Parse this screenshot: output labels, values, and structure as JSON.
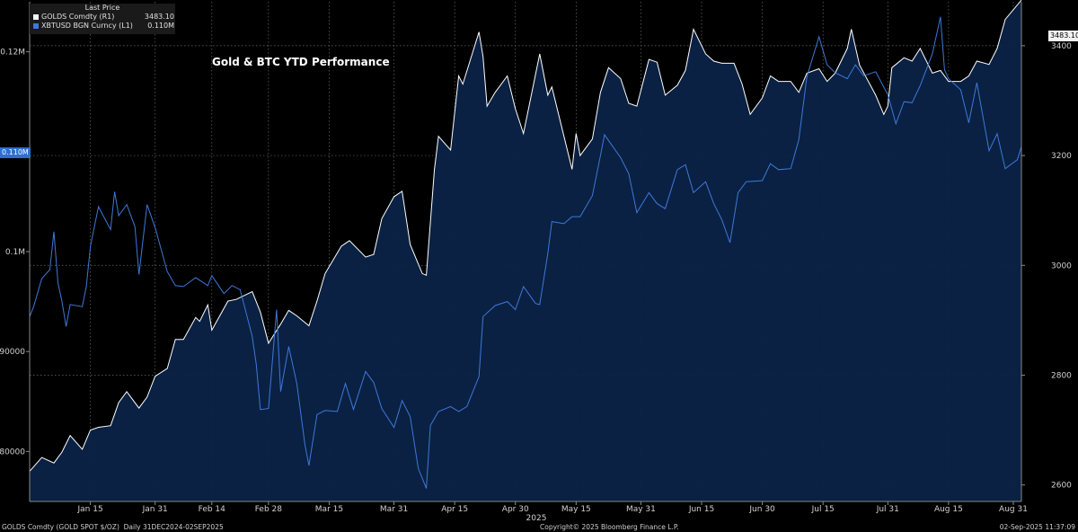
{
  "chart_data": {
    "type": "area",
    "title": "Gold & BTC YTD Performance",
    "x_tick_labels": [
      "Jan 15",
      "Jan 31",
      "Feb 14",
      "Feb 28",
      "Mar 15",
      "Mar 31",
      "Apr 15",
      "Apr 30",
      "May 15",
      "May 31",
      "Jun 15",
      "Jun 30",
      "Jul 15",
      "Jul 31",
      "Aug 15",
      "Aug 31"
    ],
    "x_year_label": "2025",
    "x_start": "2024-12-31",
    "x_end": "2025-09-02",
    "left_axis": {
      "ticks": [
        80000,
        90000,
        100000,
        120000
      ],
      "tick_labels": [
        "80000",
        "90000",
        "0.1M",
        "0.12M"
      ],
      "range": [
        75000,
        125000
      ]
    },
    "right_axis": {
      "ticks": [
        2600,
        2800,
        3000,
        3200,
        3400
      ],
      "tick_labels": [
        "2600",
        "2800",
        "3000",
        "3200",
        "3400"
      ],
      "range": [
        2570,
        3480
      ]
    },
    "series": [
      {
        "name": "GOLDS Comdty (R1)",
        "axis": "right",
        "color": "#ffffff",
        "last": "3483.10",
        "points": [
          [
            "2024-12-31",
            2625
          ],
          [
            "2025-01-03",
            2650
          ],
          [
            "2025-01-06",
            2640
          ],
          [
            "2025-01-08",
            2660
          ],
          [
            "2025-01-10",
            2690
          ],
          [
            "2025-01-13",
            2665
          ],
          [
            "2025-01-15",
            2700
          ],
          [
            "2025-01-17",
            2705
          ],
          [
            "2025-01-20",
            2708
          ],
          [
            "2025-01-22",
            2750
          ],
          [
            "2025-01-24",
            2770
          ],
          [
            "2025-01-27",
            2740
          ],
          [
            "2025-01-29",
            2760
          ],
          [
            "2025-01-31",
            2798
          ],
          [
            "2025-02-03",
            2812
          ],
          [
            "2025-02-05",
            2865
          ],
          [
            "2025-02-07",
            2865
          ],
          [
            "2025-02-10",
            2905
          ],
          [
            "2025-02-11",
            2898
          ],
          [
            "2025-02-13",
            2928
          ],
          [
            "2025-02-14",
            2882
          ],
          [
            "2025-02-18",
            2935
          ],
          [
            "2025-02-20",
            2938
          ],
          [
            "2025-02-24",
            2952
          ],
          [
            "2025-02-26",
            2915
          ],
          [
            "2025-02-28",
            2858
          ],
          [
            "2025-03-03",
            2893
          ],
          [
            "2025-03-05",
            2918
          ],
          [
            "2025-03-07",
            2908
          ],
          [
            "2025-03-10",
            2890
          ],
          [
            "2025-03-12",
            2935
          ],
          [
            "2025-03-14",
            2985
          ],
          [
            "2025-03-18",
            3035
          ],
          [
            "2025-03-20",
            3045
          ],
          [
            "2025-03-24",
            3015
          ],
          [
            "2025-03-26",
            3020
          ],
          [
            "2025-03-28",
            3085
          ],
          [
            "2025-03-31",
            3125
          ],
          [
            "2025-04-02",
            3135
          ],
          [
            "2025-04-04",
            3038
          ],
          [
            "2025-04-07",
            2985
          ],
          [
            "2025-04-08",
            2982
          ],
          [
            "2025-04-10",
            3175
          ],
          [
            "2025-04-11",
            3235
          ],
          [
            "2025-04-14",
            3210
          ],
          [
            "2025-04-16",
            3345
          ],
          [
            "2025-04-17",
            3330
          ],
          [
            "2025-04-21",
            3425
          ],
          [
            "2025-04-22",
            3380
          ],
          [
            "2025-04-23",
            3290
          ],
          [
            "2025-04-25",
            3315
          ],
          [
            "2025-04-28",
            3345
          ],
          [
            "2025-04-30",
            3285
          ],
          [
            "2025-05-02",
            3240
          ],
          [
            "2025-05-06",
            3385
          ],
          [
            "2025-05-08",
            3310
          ],
          [
            "2025-05-09",
            3325
          ],
          [
            "2025-05-12",
            3235
          ],
          [
            "2025-05-14",
            3175
          ],
          [
            "2025-05-15",
            3240
          ],
          [
            "2025-05-16",
            3200
          ],
          [
            "2025-05-19",
            3230
          ],
          [
            "2025-05-21",
            3315
          ],
          [
            "2025-05-23",
            3360
          ],
          [
            "2025-05-26",
            3340
          ],
          [
            "2025-05-28",
            3295
          ],
          [
            "2025-05-30",
            3290
          ],
          [
            "2025-06-02",
            3375
          ],
          [
            "2025-06-04",
            3370
          ],
          [
            "2025-06-06",
            3310
          ],
          [
            "2025-06-09",
            3328
          ],
          [
            "2025-06-11",
            3355
          ],
          [
            "2025-06-13",
            3430
          ],
          [
            "2025-06-16",
            3385
          ],
          [
            "2025-06-18",
            3372
          ],
          [
            "2025-06-20",
            3368
          ],
          [
            "2025-06-23",
            3368
          ],
          [
            "2025-06-25",
            3330
          ],
          [
            "2025-06-27",
            3275
          ],
          [
            "2025-06-30",
            3305
          ],
          [
            "2025-07-02",
            3345
          ],
          [
            "2025-07-04",
            3335
          ],
          [
            "2025-07-07",
            3335
          ],
          [
            "2025-07-09",
            3315
          ],
          [
            "2025-07-11",
            3350
          ],
          [
            "2025-07-14",
            3358
          ],
          [
            "2025-07-16",
            3335
          ],
          [
            "2025-07-18",
            3350
          ],
          [
            "2025-07-21",
            3395
          ],
          [
            "2025-07-22",
            3430
          ],
          [
            "2025-07-24",
            3365
          ],
          [
            "2025-07-28",
            3310
          ],
          [
            "2025-07-30",
            3275
          ],
          [
            "2025-07-31",
            3290
          ],
          [
            "2025-08-01",
            3360
          ],
          [
            "2025-08-04",
            3378
          ],
          [
            "2025-08-06",
            3372
          ],
          [
            "2025-08-08",
            3395
          ],
          [
            "2025-08-11",
            3350
          ],
          [
            "2025-08-13",
            3355
          ],
          [
            "2025-08-15",
            3335
          ],
          [
            "2025-08-18",
            3335
          ],
          [
            "2025-08-20",
            3345
          ],
          [
            "2025-08-22",
            3372
          ],
          [
            "2025-08-25",
            3366
          ],
          [
            "2025-08-27",
            3395
          ],
          [
            "2025-08-29",
            3448
          ],
          [
            "2025-09-02",
            3483.1
          ]
        ]
      },
      {
        "name": "XBTUSD BGN Curncy (L1)",
        "axis": "left",
        "color": "#3f78d8",
        "last": "0.110M",
        "points": [
          [
            "2024-12-31",
            93500
          ],
          [
            "2025-01-01",
            94500
          ],
          [
            "2025-01-03",
            97300
          ],
          [
            "2025-01-05",
            98200
          ],
          [
            "2025-01-06",
            102000
          ],
          [
            "2025-01-07",
            96900
          ],
          [
            "2025-01-08",
            95000
          ],
          [
            "2025-01-09",
            92500
          ],
          [
            "2025-01-10",
            94700
          ],
          [
            "2025-01-13",
            94500
          ],
          [
            "2025-01-14",
            96500
          ],
          [
            "2025-01-15",
            100500
          ],
          [
            "2025-01-17",
            104500
          ],
          [
            "2025-01-20",
            102200
          ],
          [
            "2025-01-21",
            106000
          ],
          [
            "2025-01-22",
            103600
          ],
          [
            "2025-01-24",
            104700
          ],
          [
            "2025-01-26",
            102500
          ],
          [
            "2025-01-27",
            97700
          ],
          [
            "2025-01-29",
            104700
          ],
          [
            "2025-01-31",
            102400
          ],
          [
            "2025-02-03",
            98000
          ],
          [
            "2025-02-05",
            96600
          ],
          [
            "2025-02-07",
            96500
          ],
          [
            "2025-02-10",
            97400
          ],
          [
            "2025-02-13",
            96600
          ],
          [
            "2025-02-14",
            97600
          ],
          [
            "2025-02-17",
            95800
          ],
          [
            "2025-02-19",
            96600
          ],
          [
            "2025-02-21",
            96200
          ],
          [
            "2025-02-24",
            91500
          ],
          [
            "2025-02-25",
            88700
          ],
          [
            "2025-02-26",
            84200
          ],
          [
            "2025-02-28",
            84300
          ],
          [
            "2025-03-02",
            94200
          ],
          [
            "2025-03-03",
            86000
          ],
          [
            "2025-03-05",
            90500
          ],
          [
            "2025-03-07",
            86800
          ],
          [
            "2025-03-09",
            80700
          ],
          [
            "2025-03-10",
            78600
          ],
          [
            "2025-03-12",
            83700
          ],
          [
            "2025-03-14",
            84100
          ],
          [
            "2025-03-17",
            84000
          ],
          [
            "2025-03-19",
            86800
          ],
          [
            "2025-03-21",
            84200
          ],
          [
            "2025-03-24",
            88000
          ],
          [
            "2025-03-26",
            86900
          ],
          [
            "2025-03-28",
            84300
          ],
          [
            "2025-03-31",
            82400
          ],
          [
            "2025-04-02",
            85100
          ],
          [
            "2025-04-04",
            83500
          ],
          [
            "2025-04-06",
            78300
          ],
          [
            "2025-04-08",
            76300
          ],
          [
            "2025-04-09",
            82600
          ],
          [
            "2025-04-11",
            84000
          ],
          [
            "2025-04-14",
            84500
          ],
          [
            "2025-04-16",
            84000
          ],
          [
            "2025-04-18",
            84500
          ],
          [
            "2025-04-21",
            87500
          ],
          [
            "2025-04-22",
            93500
          ],
          [
            "2025-04-25",
            94600
          ],
          [
            "2025-04-28",
            95000
          ],
          [
            "2025-04-30",
            94200
          ],
          [
            "2025-05-02",
            96500
          ],
          [
            "2025-05-05",
            94800
          ],
          [
            "2025-05-06",
            94700
          ],
          [
            "2025-05-08",
            99800
          ],
          [
            "2025-05-09",
            103000
          ],
          [
            "2025-05-12",
            102800
          ],
          [
            "2025-05-14",
            103500
          ],
          [
            "2025-05-16",
            103500
          ],
          [
            "2025-05-19",
            105600
          ],
          [
            "2025-05-21",
            109600
          ],
          [
            "2025-05-22",
            111700
          ],
          [
            "2025-05-26",
            109400
          ],
          [
            "2025-05-28",
            107800
          ],
          [
            "2025-05-30",
            103900
          ],
          [
            "2025-06-02",
            105900
          ],
          [
            "2025-06-04",
            104800
          ],
          [
            "2025-06-06",
            104300
          ],
          [
            "2025-06-09",
            108200
          ],
          [
            "2025-06-11",
            108700
          ],
          [
            "2025-06-13",
            105900
          ],
          [
            "2025-06-16",
            107000
          ],
          [
            "2025-06-18",
            104800
          ],
          [
            "2025-06-20",
            103200
          ],
          [
            "2025-06-22",
            100900
          ],
          [
            "2025-06-24",
            105900
          ],
          [
            "2025-06-26",
            107000
          ],
          [
            "2025-06-30",
            107100
          ],
          [
            "2025-07-02",
            108800
          ],
          [
            "2025-07-04",
            108200
          ],
          [
            "2025-07-07",
            108300
          ],
          [
            "2025-07-09",
            111200
          ],
          [
            "2025-07-11",
            117500
          ],
          [
            "2025-07-14",
            121500
          ],
          [
            "2025-07-16",
            118700
          ],
          [
            "2025-07-18",
            117900
          ],
          [
            "2025-07-21",
            117300
          ],
          [
            "2025-07-23",
            118700
          ],
          [
            "2025-07-25",
            117600
          ],
          [
            "2025-07-28",
            118000
          ],
          [
            "2025-07-31",
            115700
          ],
          [
            "2025-08-02",
            112800
          ],
          [
            "2025-08-04",
            115000
          ],
          [
            "2025-08-06",
            114900
          ],
          [
            "2025-08-08",
            116600
          ],
          [
            "2025-08-11",
            119800
          ],
          [
            "2025-08-13",
            123500
          ],
          [
            "2025-08-14",
            118200
          ],
          [
            "2025-08-15",
            117300
          ],
          [
            "2025-08-18",
            116200
          ],
          [
            "2025-08-20",
            112900
          ],
          [
            "2025-08-22",
            116900
          ],
          [
            "2025-08-25",
            110100
          ],
          [
            "2025-08-27",
            111800
          ],
          [
            "2025-08-29",
            108300
          ],
          [
            "2025-09-01",
            109200
          ],
          [
            "2025-09-02",
            110500
          ]
        ]
      }
    ],
    "legend": {
      "header": "Last Price",
      "placement": "top-left"
    },
    "grid": true
  },
  "footer": {
    "left": "GOLDS Comdty (GOLD SPOT $/OZ)  Daily 31DEC2024-02SEP2025",
    "center": "Copyright© 2025 Bloomberg Finance L.P.",
    "right": "02-Sep-2025 11:37:09"
  },
  "colors": {
    "background": "#000000",
    "area_fill": "#0b2347",
    "gold_line": "#ffffff",
    "btc_line": "#3f78d8",
    "grid": "#6a6a6a"
  }
}
